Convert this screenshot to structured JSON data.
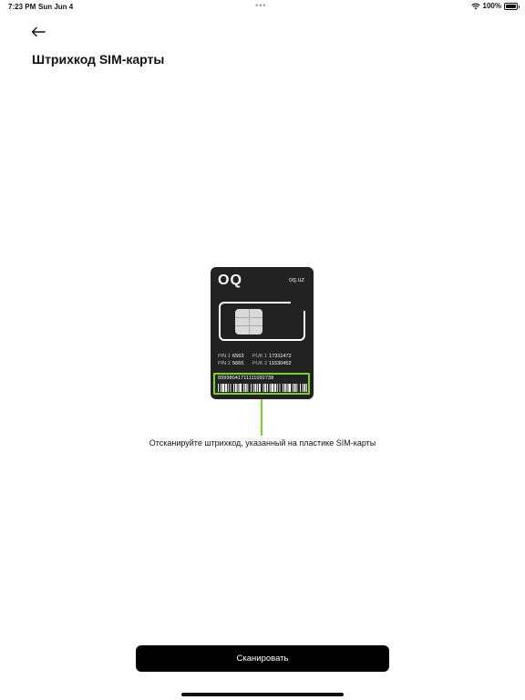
{
  "status_bar": {
    "time": "7:23 PM",
    "date": "Sun Jun 4",
    "dots": "•••",
    "battery": "100%"
  },
  "header": {
    "back_icon": "arrow-left-icon",
    "title": "Штрихкод SIM-карты"
  },
  "sim_card": {
    "logo": "OQ",
    "domain": "oq.uz",
    "pin1_label": "PIN 1",
    "pin1_value": "6563",
    "pin2_label": "PIN 2",
    "pin2_value": "5665",
    "puk1_label": "PUK 1",
    "puk1_value": "17311472",
    "puk2_label": "PUK 2",
    "puk2_value": "11530452",
    "barcode_number": "89998041711111092738",
    "highlight_color": "#7ed321"
  },
  "instruction": "Отсканируйте штрихкод, указанный на пластике SIM-карты",
  "scan_button": {
    "label": "Сканировать"
  },
  "colors": {
    "accent": "#7ed321",
    "card": "#222222",
    "button": "#000000"
  }
}
